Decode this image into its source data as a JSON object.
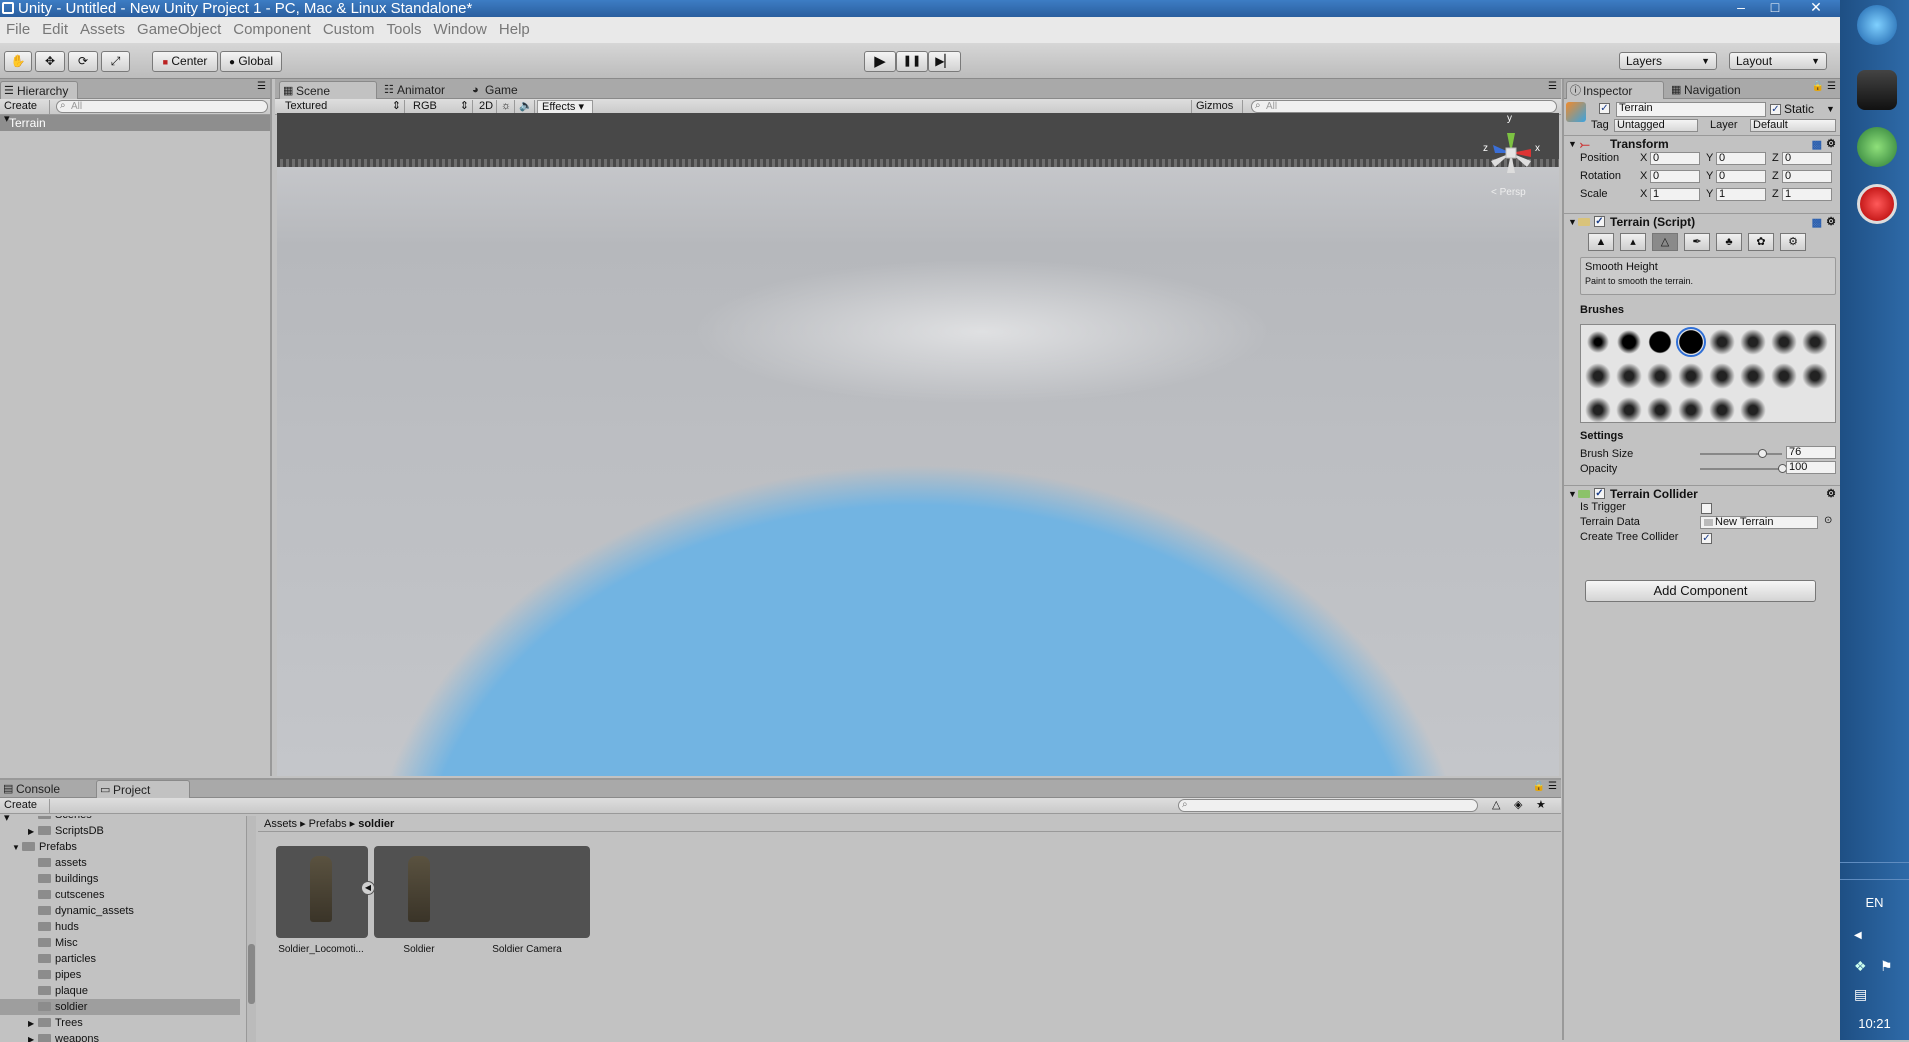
{
  "window": {
    "title": "Unity - Untitled - New Unity Project 1 - PC, Mac & Linux Standalone*",
    "minimize": "–",
    "maximize": "□",
    "close": "✕"
  },
  "menu": [
    "File",
    "Edit",
    "Assets",
    "GameObject",
    "Component",
    "Custom",
    "Tools",
    "Window",
    "Help"
  ],
  "toolbar": {
    "center": "Center",
    "global": "Global",
    "play": "▶",
    "pause": "❚❚",
    "step": "▶▏",
    "layers": "Layers",
    "layout": "Layout"
  },
  "hierarchy": {
    "tab": "Hierarchy",
    "create": "Create",
    "search_placeholder": "All",
    "items": [
      "Terrain"
    ]
  },
  "scene": {
    "tabs": [
      "Scene",
      "Animator",
      "Game"
    ],
    "render_mode": "Textured",
    "color_mode": "RGB",
    "toggle_2d": "2D",
    "effects": "Effects",
    "gizmos": "Gizmos",
    "search_placeholder": "All",
    "persp": "< Persp",
    "axis_x": "x",
    "axis_y": "y",
    "axis_z": "z"
  },
  "inspector": {
    "tabs": [
      "Inspector",
      "Navigation"
    ],
    "object_name": "Terrain",
    "static_label": "Static",
    "tag_label": "Tag",
    "tag_value": "Untagged",
    "layer_label": "Layer",
    "layer_value": "Default",
    "transform": {
      "title": "Transform",
      "rows": [
        {
          "label": "Position",
          "x": "0",
          "y": "0",
          "z": "0"
        },
        {
          "label": "Rotation",
          "x": "0",
          "y": "0",
          "z": "0"
        },
        {
          "label": "Scale",
          "x": "1",
          "y": "1",
          "z": "1"
        }
      ]
    },
    "terrain_script": {
      "title": "Terrain (Script)",
      "tool_name": "Smooth Height",
      "tool_desc": "Paint to smooth the terrain.",
      "brushes_label": "Brushes",
      "brush_count": 22,
      "selected_brush": 3,
      "settings_label": "Settings",
      "brush_size_label": "Brush Size",
      "brush_size": "76",
      "opacity_label": "Opacity",
      "opacity": "100"
    },
    "terrain_collider": {
      "title": "Terrain Collider",
      "is_trigger_label": "Is Trigger",
      "terrain_data_label": "Terrain Data",
      "terrain_data_value": "New Terrain",
      "create_tree_label": "Create Tree Collider"
    },
    "add_component": "Add Component"
  },
  "bottom": {
    "tabs": [
      "Console",
      "Project"
    ],
    "create": "Create",
    "tree": [
      {
        "label": "Scenes",
        "indent": 2
      },
      {
        "label": "ScriptsDB",
        "indent": 2
      },
      {
        "label": "Prefabs",
        "indent": 1
      },
      {
        "label": "assets",
        "indent": 2
      },
      {
        "label": "buildings",
        "indent": 2
      },
      {
        "label": "cutscenes",
        "indent": 2
      },
      {
        "label": "dynamic_assets",
        "indent": 2
      },
      {
        "label": "huds",
        "indent": 2
      },
      {
        "label": "Misc",
        "indent": 2
      },
      {
        "label": "particles",
        "indent": 2
      },
      {
        "label": "pipes",
        "indent": 2
      },
      {
        "label": "plaque",
        "indent": 2
      },
      {
        "label": "soldier",
        "indent": 2
      },
      {
        "label": "Trees",
        "indent": 2
      },
      {
        "label": "weapons",
        "indent": 2
      }
    ],
    "breadcrumb": [
      "Assets",
      "Prefabs",
      "soldier"
    ],
    "assets": [
      "Soldier_Locomoti...",
      "Soldier",
      "Soldier Camera"
    ]
  },
  "taskbar": {
    "lang": "EN",
    "clock": "10:21"
  }
}
